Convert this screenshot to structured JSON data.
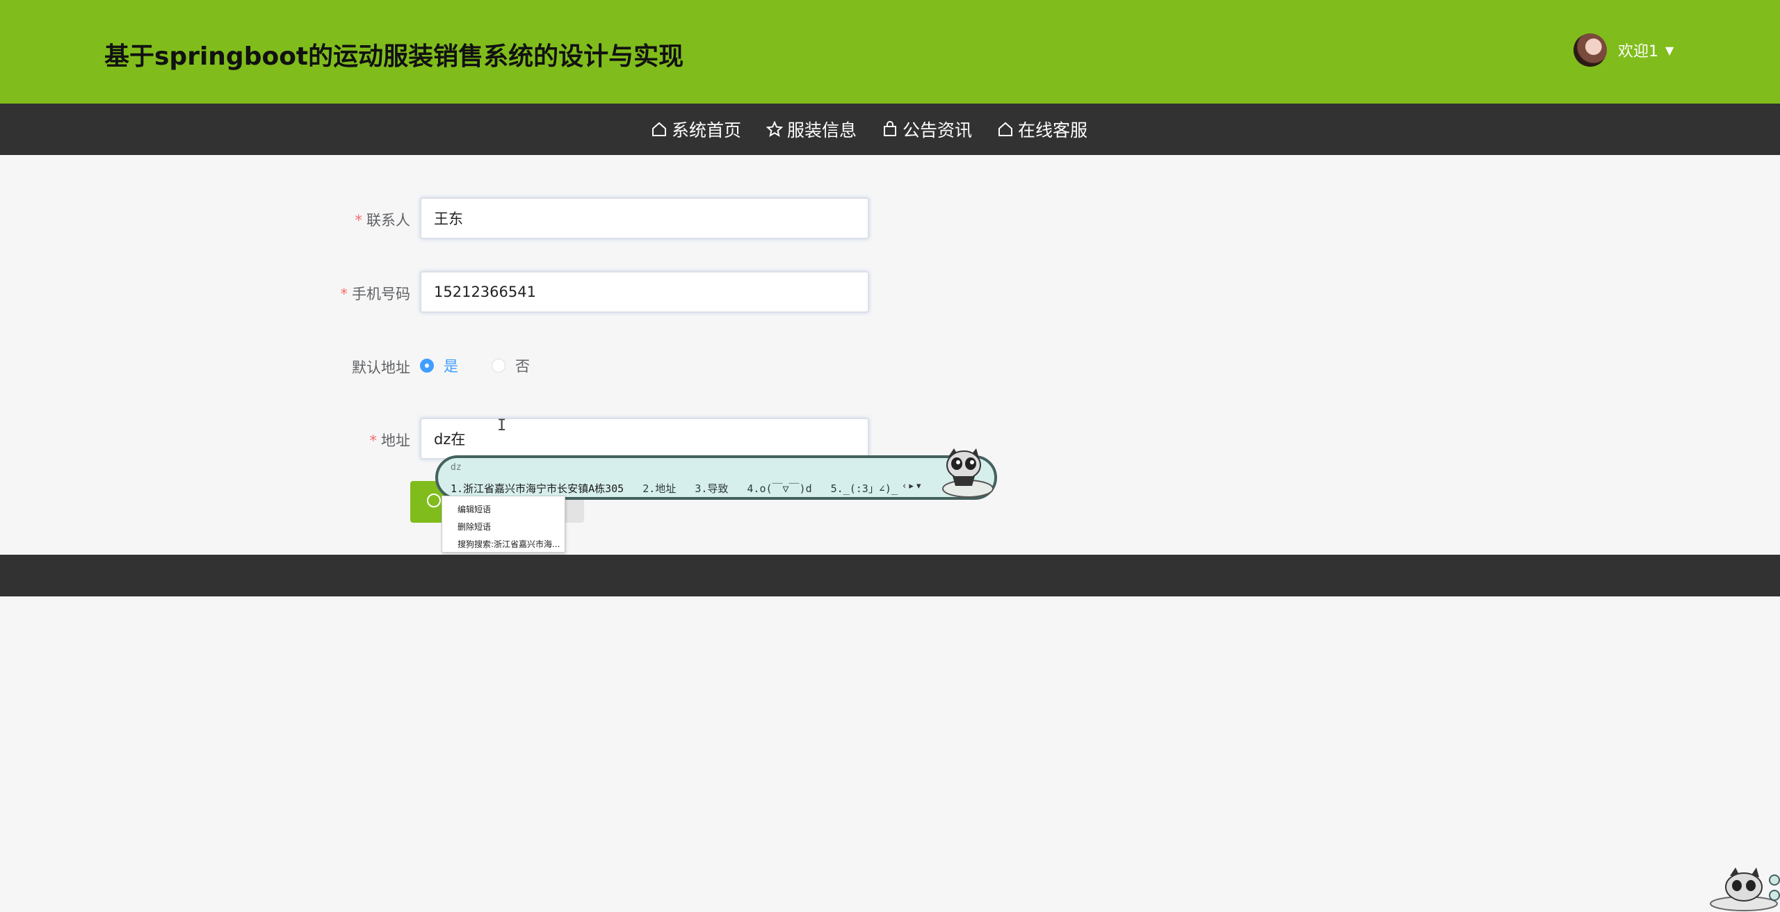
{
  "header": {
    "title": "基于springboot的运动服装销售系统的设计与实现",
    "user_greeting": "欢迎1",
    "dropdown_caret": "▼"
  },
  "nav": {
    "items": [
      {
        "label": "系统首页",
        "icon": "home-icon"
      },
      {
        "label": "服装信息",
        "icon": "star-icon"
      },
      {
        "label": "公告资讯",
        "icon": "bag-icon"
      },
      {
        "label": "在线客服",
        "icon": "home-icon"
      }
    ]
  },
  "form": {
    "required_mark": "*",
    "contact": {
      "label": "联系人",
      "value": "王东"
    },
    "phone": {
      "label": "手机号码",
      "value": "15212366541"
    },
    "default_address": {
      "label": "默认地址",
      "options": [
        {
          "label": "是",
          "checked": true
        },
        {
          "label": "否",
          "checked": false
        }
      ]
    },
    "address": {
      "label": "地址",
      "value": "dz在"
    }
  },
  "ime": {
    "composition": "dz",
    "candidates": [
      "1.浙江省嘉兴市海宁市长安镇A栋305",
      "2.地址",
      "3.导致",
      "4.o(￣▽￣)d",
      "5._(:3」∠)_"
    ],
    "page_arrows": "‹ ▸ ▾"
  },
  "context_menu": {
    "items": [
      "编辑短语",
      "删除短语",
      "搜狗搜索:浙江省嘉兴市海..."
    ]
  },
  "colors": {
    "brand_green": "#80bd1c",
    "nav_dark": "#323232",
    "radio_blue": "#409eff",
    "required_red": "#f56c6c"
  }
}
